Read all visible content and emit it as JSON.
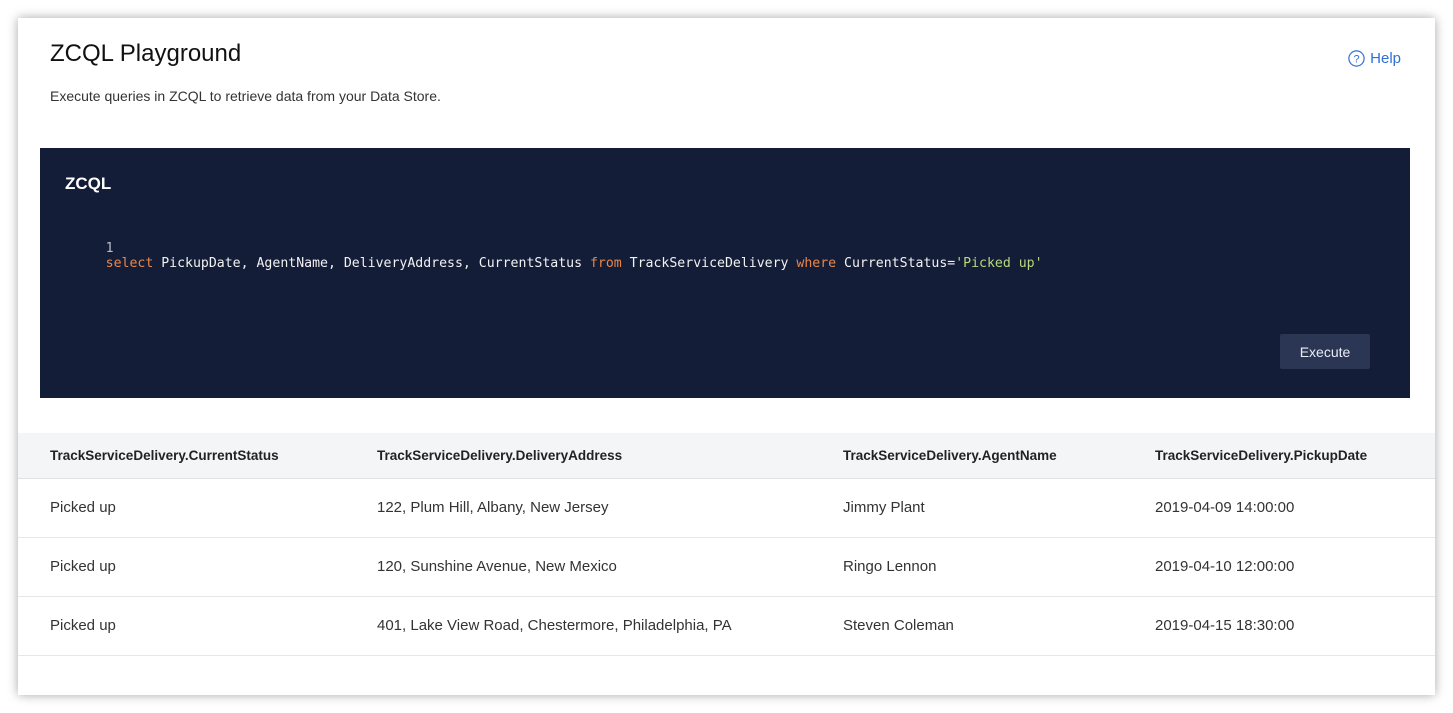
{
  "header": {
    "title": "ZCQL Playground",
    "subtitle": "Execute queries in ZCQL to retrieve data from your Data Store.",
    "help_label": "Help",
    "help_icon": "question-circle-icon",
    "link_color": "#2f6fd6"
  },
  "editor": {
    "title": "ZCQL",
    "background": "#141d37",
    "line_number": "1",
    "query_tokens": [
      {
        "text": "select",
        "kind": "kw"
      },
      {
        "text": " PickupDate, AgentName, DeliveryAddress, CurrentStatus ",
        "kind": "plain"
      },
      {
        "text": "from",
        "kind": "kw"
      },
      {
        "text": " TrackServiceDelivery ",
        "kind": "plain"
      },
      {
        "text": "where",
        "kind": "kw"
      },
      {
        "text": " CurrentStatus=",
        "kind": "plain"
      },
      {
        "text": "'Picked up'",
        "kind": "str"
      }
    ],
    "execute_label": "Execute"
  },
  "results": {
    "columns": [
      "TrackServiceDelivery.CurrentStatus",
      "TrackServiceDelivery.DeliveryAddress",
      "TrackServiceDelivery.AgentName",
      "TrackServiceDelivery.PickupDate"
    ],
    "rows": [
      [
        "Picked up",
        "122, Plum Hill, Albany, New Jersey",
        "Jimmy Plant",
        "2019-04-09 14:00:00"
      ],
      [
        "Picked up",
        "120, Sunshine Avenue, New Mexico",
        "Ringo Lennon",
        "2019-04-10 12:00:00"
      ],
      [
        "Picked up",
        "401, Lake View Road, Chestermore, Philadelphia, PA",
        "Steven Coleman",
        "2019-04-15 18:30:00"
      ]
    ]
  }
}
